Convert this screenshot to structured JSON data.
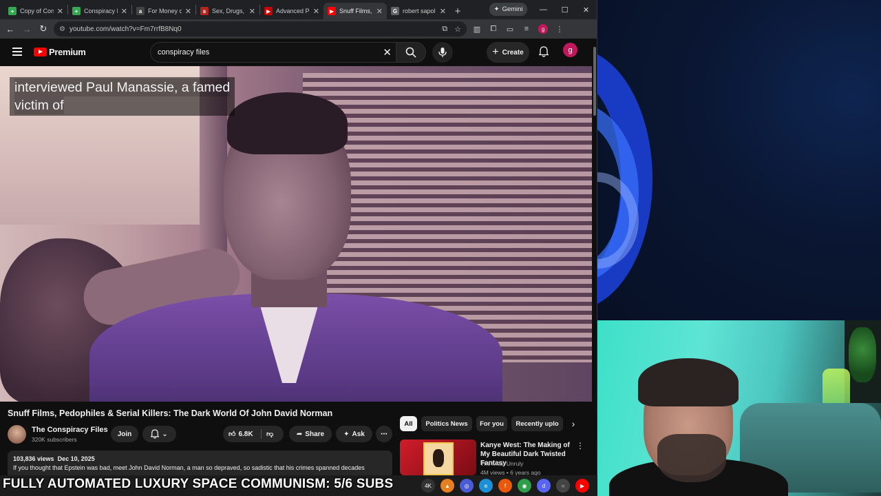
{
  "browser": {
    "tabs": [
      {
        "title": "Copy of Con",
        "favicon_color": "#34a853",
        "favicon_glyph": "+"
      },
      {
        "title": "Conspiracy I",
        "favicon_color": "#34a853",
        "favicon_glyph": "+"
      },
      {
        "title": "For Money o",
        "favicon_color": "#444444",
        "favicon_glyph": "a"
      },
      {
        "title": "Sex, Drugs, I",
        "favicon_color": "#b3261e",
        "favicon_glyph": "s"
      },
      {
        "title": "Advanced Pa",
        "favicon_color": "#cc0000",
        "favicon_glyph": "▶"
      },
      {
        "title": "Snuff Films,",
        "favicon_color": "#ff0000",
        "favicon_glyph": "▶",
        "active": true
      },
      {
        "title": "robert sapol",
        "favicon_color": "#5f6368",
        "favicon_glyph": "G"
      }
    ],
    "gemini_label": "Gemini",
    "url": "youtube.com/watch?v=Fm7rrfB8Nq0",
    "profile_initial": "g"
  },
  "youtube": {
    "logo_word": "Premium",
    "search_value": "conspiracy files",
    "create_label": "Create",
    "avatar_initial": "g",
    "caption_line1": "interviewed Paul Manassie, a famed",
    "caption_line2": "victim of",
    "video_title": "Snuff Films, Pedophiles & Serial Killers: The Dark World Of John David Norman",
    "channel_name": "The Conspiracy Files",
    "channel_subs": "320K subscribers",
    "join_label": "Join",
    "like_count": "6.8K",
    "share_label": "Share",
    "ask_label": "Ask",
    "views": "103,836 views",
    "date": "Dec 10, 2025",
    "description": "If you thought that Epstein was bad, meet John David Norman, a man so depraved, so sadistic that his crimes spanned decades",
    "chips": [
      "All",
      "Politics News",
      "For you",
      "Recently uplo"
    ],
    "recommendation": {
      "title": "Kanye West: The Making of My Beautiful Dark Twisted Fantasy",
      "channel": "The Most Unruly",
      "meta": "4M views • 6 years ago"
    }
  },
  "overlay": {
    "banner_text": "FULLY AUTOMATED LUXURY SPACE COMMUNISM: 5/6 SUBS"
  },
  "tray_icons": [
    {
      "name": "4k-icon",
      "glyph": "4K",
      "color": "#333333"
    },
    {
      "name": "vlc-icon",
      "glyph": "▲",
      "color": "#e67e22"
    },
    {
      "name": "app-icon",
      "glyph": "◎",
      "color": "#4a5bd6"
    },
    {
      "name": "edge-icon",
      "glyph": "e",
      "color": "#1d8fd6"
    },
    {
      "name": "firefox-icon",
      "glyph": "f",
      "color": "#e8590c"
    },
    {
      "name": "chrome-icon",
      "glyph": "◉",
      "color": "#2e9e4a"
    },
    {
      "name": "discord-icon",
      "glyph": "d",
      "color": "#5865f2"
    },
    {
      "name": "obs-icon",
      "glyph": "○",
      "color": "#444444"
    },
    {
      "name": "youtube-icon",
      "glyph": "▶",
      "color": "#ff0000"
    }
  ]
}
